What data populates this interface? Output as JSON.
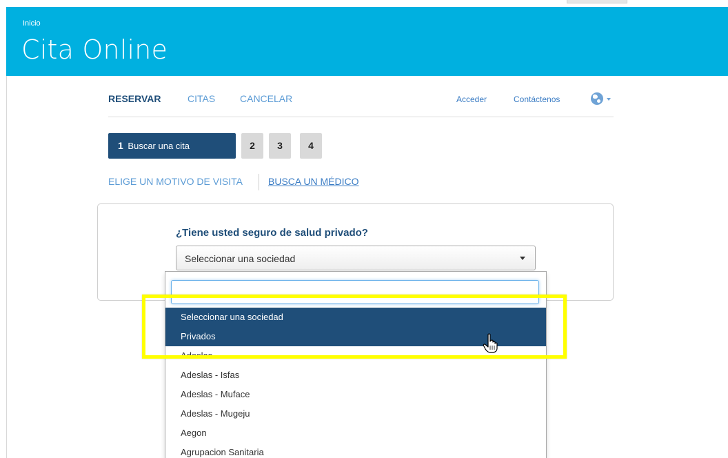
{
  "header": {
    "breadcrumb": "Inicio",
    "title": "Cita Online"
  },
  "nav": {
    "items": [
      "RESERVAR",
      "CITAS",
      "CANCELAR"
    ],
    "active": "RESERVAR",
    "login": "Acceder",
    "contact": "Contáctenos",
    "language_icon": "globe-icon"
  },
  "steps": {
    "current_number": "1",
    "current_label": "Buscar una cita",
    "others": [
      "2",
      "3",
      "4"
    ]
  },
  "subtabs": {
    "reason": "ELIGE UN MOTIVO DE VISITA",
    "doctor": "BUSCA UN MÉDICO"
  },
  "form": {
    "question": "¿Tiene usted seguro de salud privado?",
    "select_value": "Seleccionar una sociedad",
    "search_value": ""
  },
  "dropdown": {
    "options": [
      "Seleccionar una sociedad",
      "Privados",
      "Adeslas",
      "Adeslas - Isfas",
      "Adeslas - Muface",
      "Adeslas - Mugeju",
      "Aegon",
      "Agrupacion Sanitaria"
    ],
    "highlighted": [
      "Seleccionar una sociedad",
      "Privados"
    ]
  },
  "colors": {
    "header_bg": "#00b0e0",
    "primary": "#1f4e79",
    "link": "#5b9bd5",
    "highlight_frame": "#ffff00"
  }
}
